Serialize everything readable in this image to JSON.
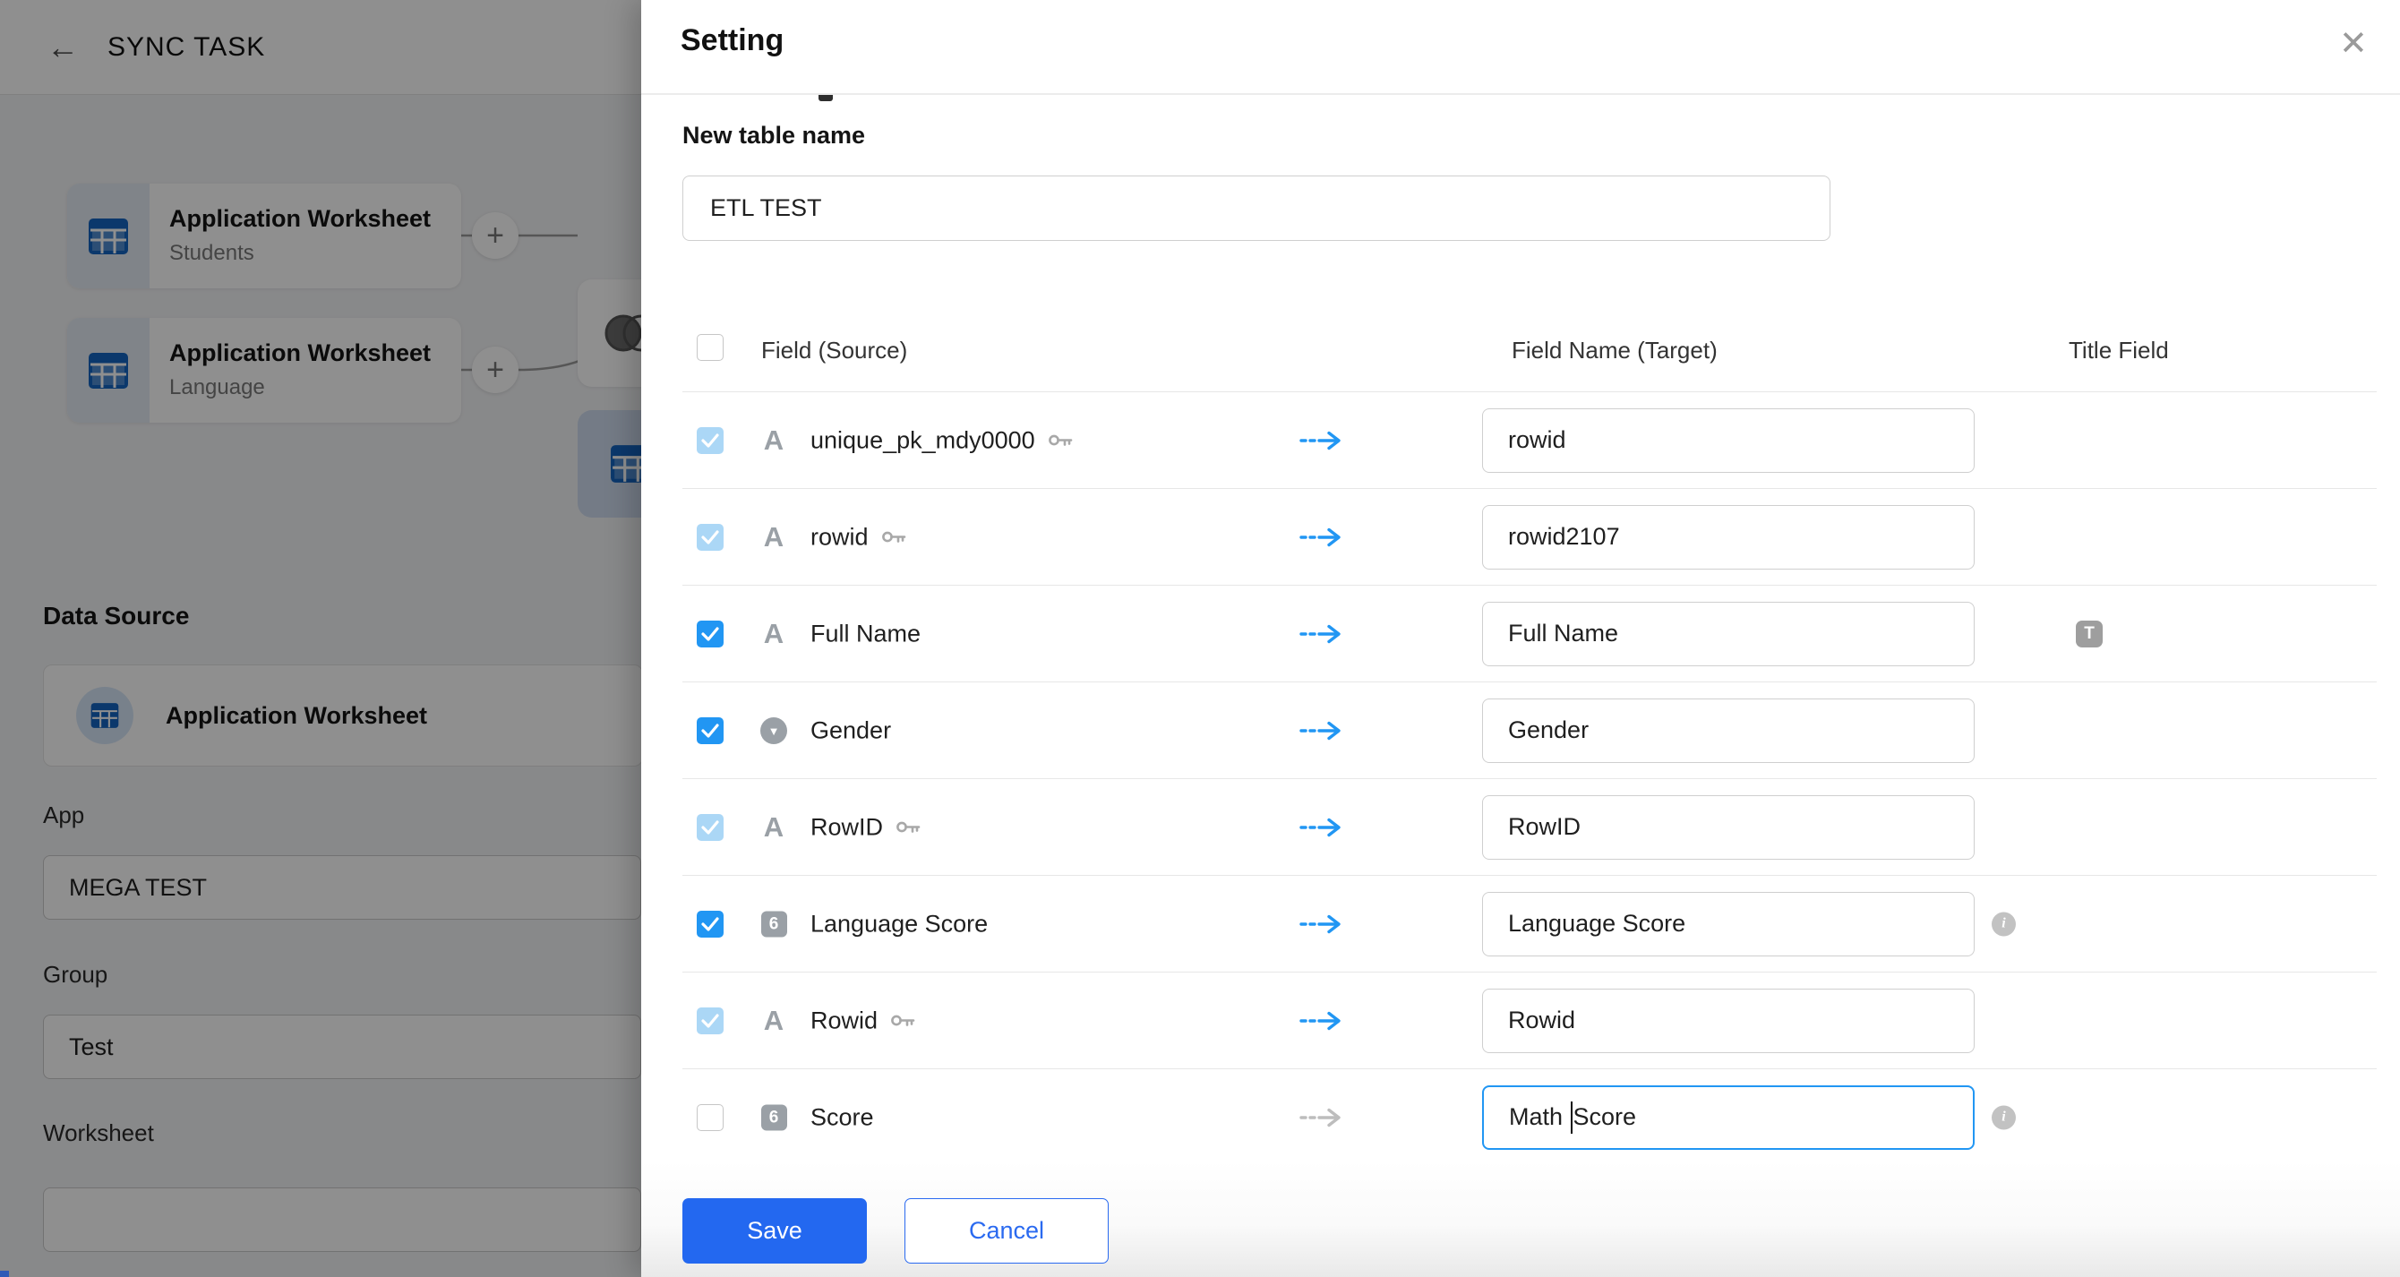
{
  "background": {
    "header": {
      "title": "SYNC TASK"
    },
    "canvas": {
      "nodes": [
        {
          "title": "Application Worksheet",
          "subtitle": "Students"
        },
        {
          "title": "Application Worksheet",
          "subtitle": "Language"
        }
      ]
    },
    "panel": {
      "data_source_label": "Data Source",
      "data_source_value": "Application Worksheet",
      "fields": [
        {
          "label": "App",
          "value": "MEGA TEST"
        },
        {
          "label": "Group",
          "value": "Test"
        },
        {
          "label": "Worksheet",
          "value": ""
        }
      ]
    }
  },
  "modal": {
    "title": "Setting",
    "new_table": {
      "label": "New table name",
      "value": "ETL TEST"
    },
    "table": {
      "headers": {
        "source": "Field (Source)",
        "target": "Field Name (Target)",
        "title_field": "Title Field"
      },
      "rows": [
        {
          "type": "text",
          "source": "unique_pk_mdy0000",
          "pk": true,
          "checked": true,
          "disabled": true,
          "target": "rowid",
          "info": false,
          "title": false
        },
        {
          "type": "text",
          "source": "rowid",
          "pk": true,
          "checked": true,
          "disabled": true,
          "target": "rowid2107",
          "info": false,
          "title": false
        },
        {
          "type": "text",
          "source": "Full Name",
          "pk": false,
          "checked": true,
          "disabled": false,
          "target": "Full Name",
          "info": false,
          "title": true
        },
        {
          "type": "dropdown",
          "source": "Gender",
          "pk": false,
          "checked": true,
          "disabled": false,
          "target": "Gender",
          "info": false,
          "title": false
        },
        {
          "type": "text",
          "source": "RowID",
          "pk": true,
          "checked": true,
          "disabled": true,
          "target": "RowID",
          "info": false,
          "title": false
        },
        {
          "type": "number",
          "source": "Language Score",
          "pk": false,
          "checked": true,
          "disabled": false,
          "target": "Language Score",
          "info": true,
          "title": false
        },
        {
          "type": "text",
          "source": "Rowid",
          "pk": true,
          "checked": true,
          "disabled": true,
          "target": "Rowid",
          "info": false,
          "title": false
        },
        {
          "type": "number",
          "source": "Score",
          "pk": false,
          "checked": false,
          "disabled": false,
          "target": "Math Score",
          "target_before_cursor": "Math ",
          "target_after_cursor": "Score",
          "focused": true,
          "info": true,
          "title": false
        }
      ]
    },
    "footer": {
      "save": "Save",
      "cancel": "Cancel"
    }
  },
  "icons": {
    "back": "←",
    "close": "✕",
    "plus": "+",
    "text_type": "A",
    "dropdown_caret": "▼",
    "number_type": "6",
    "info": "i",
    "title_badge": "T"
  },
  "colors": {
    "primary": "#2196f3",
    "save_button": "#2368f0",
    "cancel_accent": "#2a6af0",
    "disabled_check": "#abd7f6",
    "table_icon_blue": "#1565c0",
    "icon_gray": "#9aa0a6"
  }
}
